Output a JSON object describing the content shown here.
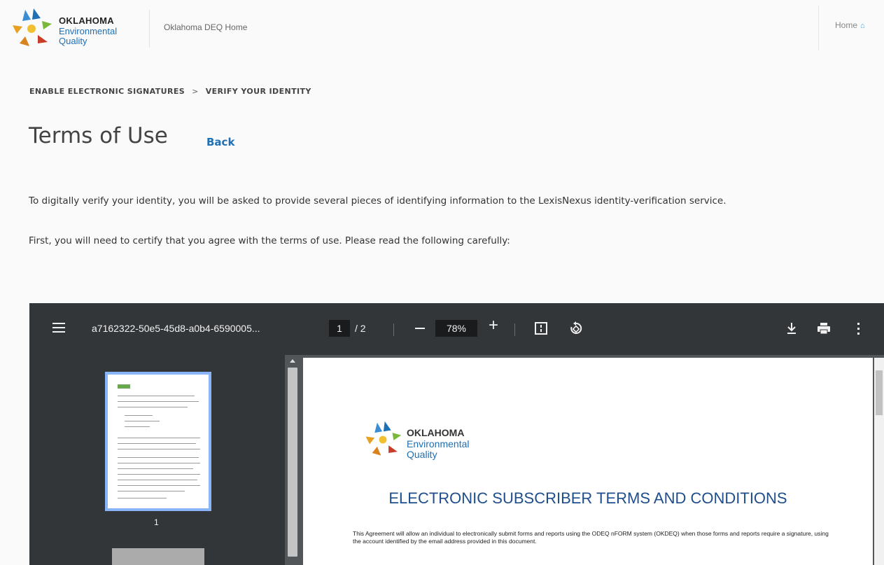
{
  "header": {
    "logo": {
      "line1": "OKLAHOMA",
      "line2": "Environmental",
      "line3": "Quality"
    },
    "home_link": "Oklahoma DEQ Home",
    "right_home": "Home"
  },
  "breadcrumb": {
    "items": [
      "ENABLE ELECTRONIC SIGNATURES",
      "VERIFY YOUR IDENTITY"
    ],
    "separator": ">"
  },
  "page": {
    "title": "Terms of Use",
    "back_label": "Back",
    "paragraph1": "To digitally verify your identity, you will be asked to provide several pieces of identifying information to the LexisNexus identity-verification service.",
    "paragraph2": "First, you will need to certify that you agree with the terms of use. Please read the following carefully:"
  },
  "pdf_viewer": {
    "filename": "a7162322-50e5-45d8-a0b4-6590005...",
    "current_page": "1",
    "total_pages": "/ 2",
    "zoom": "78%",
    "thumbnail_label": "1",
    "document": {
      "logo": {
        "line1": "OKLAHOMA",
        "line2": "Environmental",
        "line3": "Quality"
      },
      "title": "ELECTRONIC SUBSCRIBER TERMS AND CONDITIONS",
      "paragraph": "This Agreement will allow an individual to electronically submit forms and reports using the ODEQ nFORM system (OKDEQ) when those forms and reports require a signature, using the account identified by the email address provided in this document."
    }
  },
  "colors": {
    "accent": "#1f6fb5",
    "toolbar": "#323639",
    "viewer_bg": "#525659",
    "thumb_border": "#8ab4f8",
    "doc_title": "#1f4e8c"
  },
  "icons": [
    "menu-icon",
    "minus-icon",
    "plus-icon",
    "fit-page-icon",
    "rotate-icon",
    "download-icon",
    "print-icon",
    "more-vert-icon",
    "home-icon"
  ]
}
